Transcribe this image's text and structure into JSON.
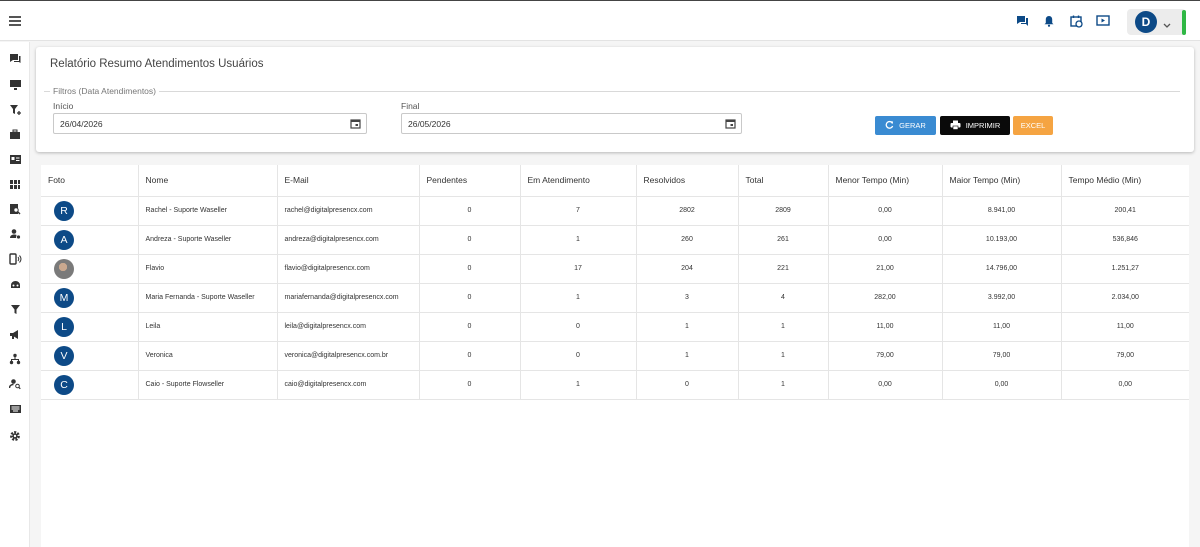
{
  "report": {
    "title": "Relatório Resumo Atendimentos Usuários",
    "filters_legend": "Filtros (Data Atendimentos)",
    "start_label": "Início",
    "start_value": "26/04/2026",
    "end_label": "Final",
    "end_value": "26/05/2026",
    "buttons": {
      "generate": "GERAR",
      "print": "IMPRIMIR",
      "excel": "EXCEL"
    }
  },
  "user": {
    "initial": "D"
  },
  "colors": {
    "primary": "#0d4a87",
    "generate": "#3a8bd2",
    "print": "#0a0a0a",
    "excel": "#f5a442",
    "status": "#2fb744"
  },
  "table": {
    "headers": [
      "Foto",
      "Nome",
      "E-Mail",
      "Pendentes",
      "Em Atendimento",
      "Resolvidos",
      "Total",
      "Menor Tempo (Min)",
      "Maior Tempo (Min)",
      "Tempo Médio (Min)"
    ],
    "rows": [
      {
        "initial": "R",
        "photo": false,
        "name": "Rachel - Suporte Waseller",
        "email": "rachel@digitalpresencx.com",
        "pending": "0",
        "in_service": "7",
        "resolved": "2802",
        "total": "2809",
        "min": "0,00",
        "max": "8.941,00",
        "avg": "200,41"
      },
      {
        "initial": "A",
        "photo": false,
        "name": "Andreza - Suporte Waseller",
        "email": "andreza@digitalpresencx.com",
        "pending": "0",
        "in_service": "1",
        "resolved": "260",
        "total": "261",
        "min": "0,00",
        "max": "10.193,00",
        "avg": "536,846"
      },
      {
        "initial": "",
        "photo": true,
        "name": "Flavio",
        "email": "flavio@digitalpresencx.com",
        "pending": "0",
        "in_service": "17",
        "resolved": "204",
        "total": "221",
        "min": "21,00",
        "max": "14.796,00",
        "avg": "1.251,27"
      },
      {
        "initial": "M",
        "photo": false,
        "name": "Maria Fernanda - Suporte Waseller",
        "email": "mariafernanda@digitalpresencx.com",
        "pending": "0",
        "in_service": "1",
        "resolved": "3",
        "total": "4",
        "min": "282,00",
        "max": "3.992,00",
        "avg": "2.034,00"
      },
      {
        "initial": "L",
        "photo": false,
        "name": "Leila",
        "email": "leila@digitalpresencx.com",
        "pending": "0",
        "in_service": "0",
        "resolved": "1",
        "total": "1",
        "min": "11,00",
        "max": "11,00",
        "avg": "11,00"
      },
      {
        "initial": "V",
        "photo": false,
        "name": "Veronica",
        "email": "veronica@digitalpresencx.com.br",
        "pending": "0",
        "in_service": "0",
        "resolved": "1",
        "total": "1",
        "min": "79,00",
        "max": "79,00",
        "avg": "79,00"
      },
      {
        "initial": "C",
        "photo": false,
        "name": "Caio - Suporte Flowseller",
        "email": "caio@digitalpresencx.com",
        "pending": "0",
        "in_service": "1",
        "resolved": "0",
        "total": "1",
        "min": "0,00",
        "max": "0,00",
        "avg": "0,00"
      }
    ]
  }
}
